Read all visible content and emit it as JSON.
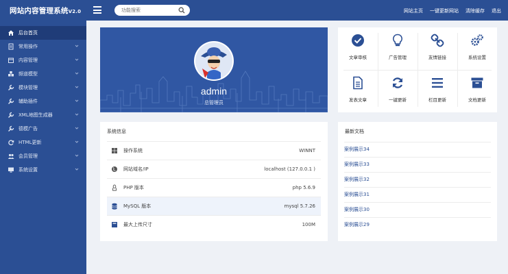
{
  "header": {
    "brand": "网站内容管理系统",
    "version": "V2.0",
    "search_placeholder": "功能搜索",
    "links": [
      "网站主页",
      "一键更新网站",
      "清除缓存",
      "退出"
    ]
  },
  "sidebar": {
    "items": [
      {
        "label": "后台首页",
        "icon": "home-icon",
        "active": true
      },
      {
        "label": "常用操作",
        "icon": "document-icon"
      },
      {
        "label": "内容管理",
        "icon": "folder-icon"
      },
      {
        "label": "频道模型",
        "icon": "cubes-icon"
      },
      {
        "label": "模块管理",
        "icon": "wrench-icon"
      },
      {
        "label": "辅助插件",
        "icon": "wrench-icon"
      },
      {
        "label": "XML地图生成器",
        "icon": "wrench-icon"
      },
      {
        "label": "德模广告",
        "icon": "wrench-icon"
      },
      {
        "label": "HTML更新",
        "icon": "refresh-icon"
      },
      {
        "label": "会员管理",
        "icon": "users-icon"
      },
      {
        "label": "系统设置",
        "icon": "monitor-icon"
      }
    ]
  },
  "profile": {
    "name": "admin",
    "role": "总管理员"
  },
  "quick_actions": [
    {
      "label": "文章审核",
      "icon": "check-circle-icon"
    },
    {
      "label": "广告管理",
      "icon": "lightbulb-icon"
    },
    {
      "label": "友情链接",
      "icon": "link-icon"
    },
    {
      "label": "系统设置",
      "icon": "gears-icon"
    },
    {
      "label": "发表文章",
      "icon": "file-text-icon"
    },
    {
      "label": "一键更新",
      "icon": "refresh-icon"
    },
    {
      "label": "栏目更新",
      "icon": "list-icon"
    },
    {
      "label": "文档更新",
      "icon": "archive-icon"
    }
  ],
  "system_info": {
    "title": "系统信息",
    "rows": [
      {
        "label": "操作系统",
        "value": "WINNT",
        "icon": "windows-icon"
      },
      {
        "label": "网站域名/IP",
        "value": "localhost (127.0.0.1 )",
        "icon": "globe-icon"
      },
      {
        "label": "PHP 版本",
        "value": "php 5.6.9",
        "icon": "linux-icon"
      },
      {
        "label": "MySQL 版本",
        "value": "mysql 5.7.26",
        "icon": "database-icon"
      },
      {
        "label": "最大上传尺寸",
        "value": "100M",
        "icon": "upload-icon"
      }
    ]
  },
  "latest": {
    "title": "最新文档",
    "items": [
      "案例展示34",
      "案例展示33",
      "案例展示32",
      "案例展示31",
      "案例展示30",
      "案例展示29"
    ]
  },
  "colors": {
    "primary": "#2b4f94",
    "sidebar_active": "#1f3c78",
    "banner": "#3057a3"
  }
}
